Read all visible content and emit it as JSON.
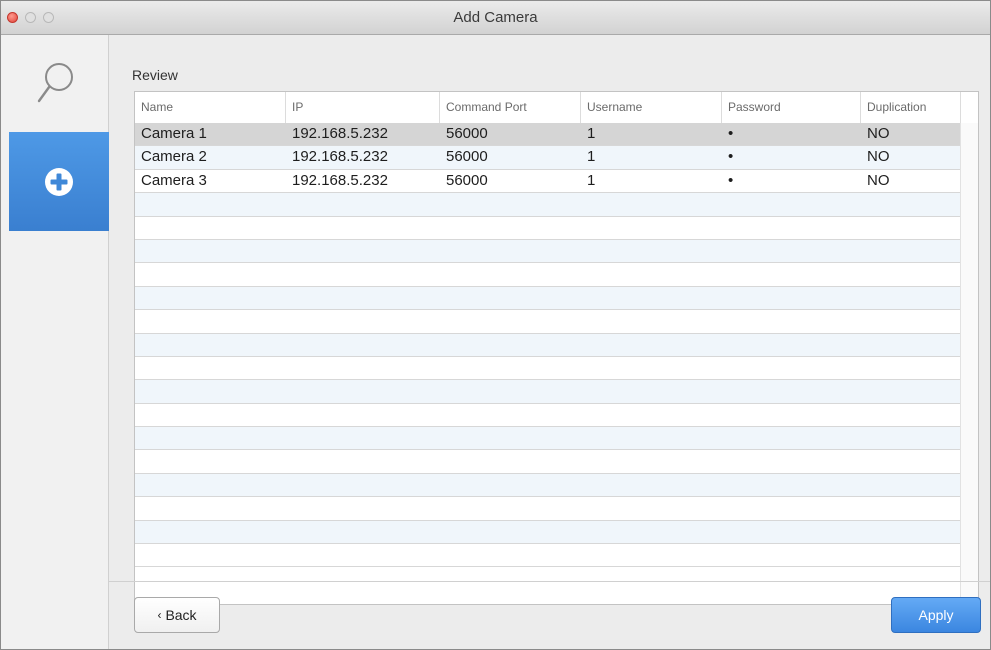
{
  "window": {
    "title": "Add Camera"
  },
  "sidebar": {
    "items": [
      {
        "name": "search",
        "icon": "search-icon"
      },
      {
        "name": "add",
        "icon": "plus-circle-icon",
        "active": true
      }
    ],
    "active_color": "#3f88d8"
  },
  "review": {
    "label": "Review",
    "columns": [
      "Name",
      "IP",
      "Command Port",
      "Username",
      "Password",
      "Duplication"
    ],
    "rows": [
      {
        "name": "Camera 1",
        "ip": "192.168.5.232",
        "port": "56000",
        "username": "1",
        "password": "•",
        "duplication": "NO",
        "selected": true
      },
      {
        "name": "Camera 2",
        "ip": "192.168.5.232",
        "port": "56000",
        "username": "1",
        "password": "•",
        "duplication": "NO",
        "selected": false
      },
      {
        "name": "Camera 3",
        "ip": "192.168.5.232",
        "port": "56000",
        "username": "1",
        "password": "•",
        "duplication": "NO",
        "selected": false
      }
    ],
    "empty_rows": 16
  },
  "buttons": {
    "back_chevron": "‹",
    "back_label": "Back",
    "apply_label": "Apply"
  }
}
